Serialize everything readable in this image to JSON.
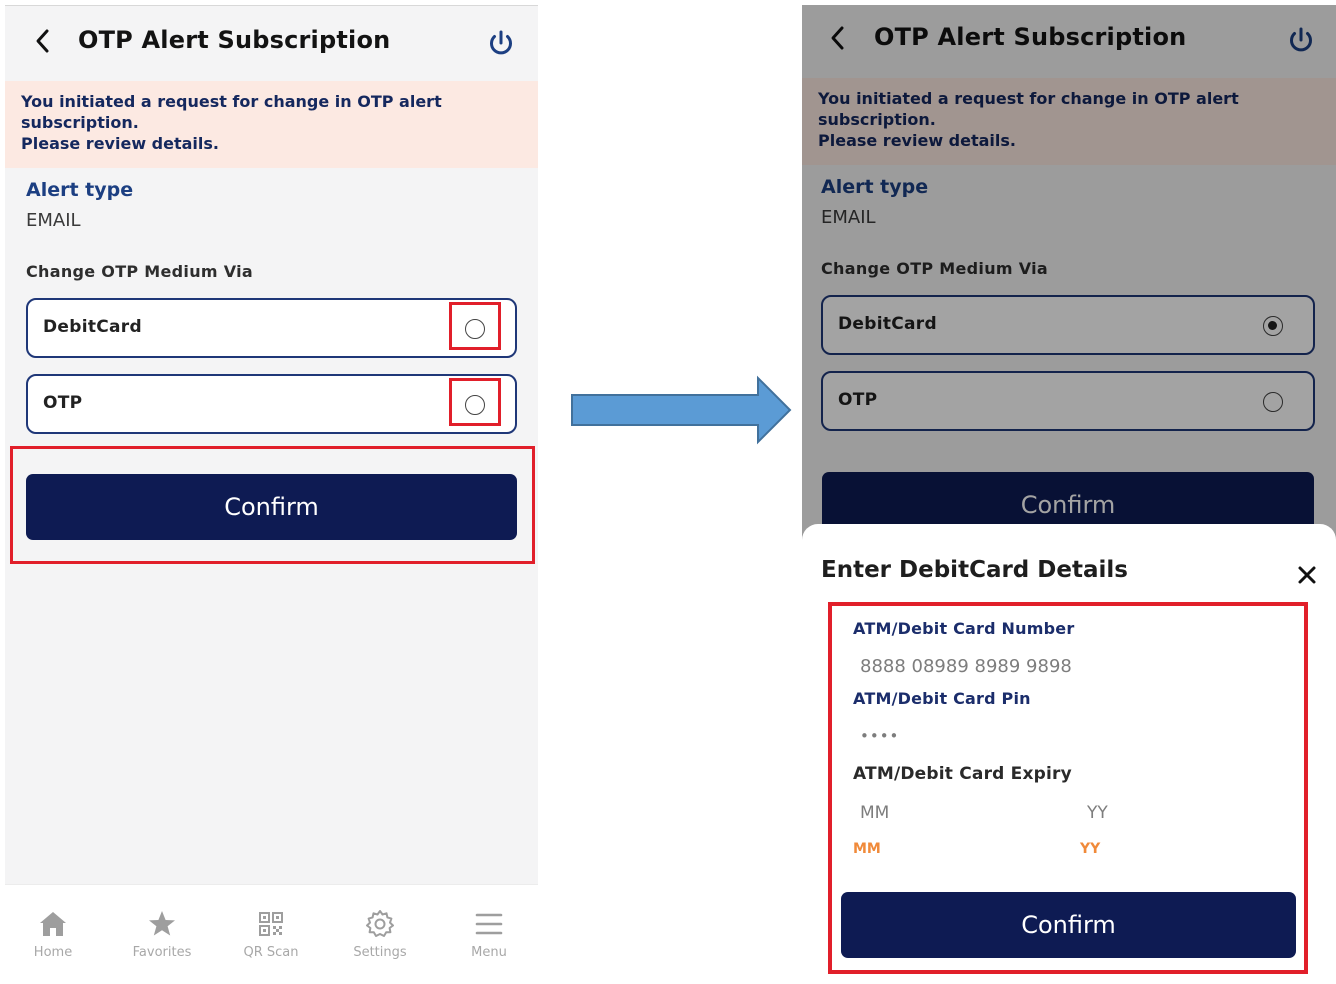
{
  "header": {
    "title": "OTP Alert Subscription"
  },
  "banner": {
    "line1": "You initiated a request for change in OTP alert",
    "line2": "subscription.",
    "line3": "Please review details."
  },
  "alert_type": {
    "label": "Alert type",
    "value": "EMAIL"
  },
  "change_medium": {
    "label": "Change OTP Medium Via"
  },
  "options": [
    {
      "label": "DebitCard"
    },
    {
      "label": "OTP"
    }
  ],
  "right_selected_option": "DebitCard",
  "confirm_label": "Confirm",
  "bottom_nav": [
    {
      "label": "Home",
      "icon": "home-icon"
    },
    {
      "label": "Favorites",
      "icon": "star-icon"
    },
    {
      "label": "QR Scan",
      "icon": "qr-icon"
    },
    {
      "label": "Settings",
      "icon": "gear-icon"
    },
    {
      "label": "Menu",
      "icon": "hamburger-icon"
    }
  ],
  "sheet": {
    "title": "Enter DebitCard Details",
    "card_number_label": "ATM/Debit Card Number",
    "card_number_value": "8888 08989 8989 9898",
    "pin_label": "ATM/Debit Card Pin",
    "pin_value": "••••",
    "expiry_label": "ATM/Debit Card Expiry",
    "expiry_mm_placeholder": "MM",
    "expiry_yy_placeholder": "YY",
    "expiry_mm_error": "MM",
    "expiry_yy_error": "YY",
    "confirm_label": "Confirm"
  },
  "colors": {
    "primary": "#0e1b53",
    "banner_bg": "#fce9e2",
    "highlight": "#e11f2a",
    "arrow": "#5b9bd5",
    "error": "#f08a3a"
  }
}
